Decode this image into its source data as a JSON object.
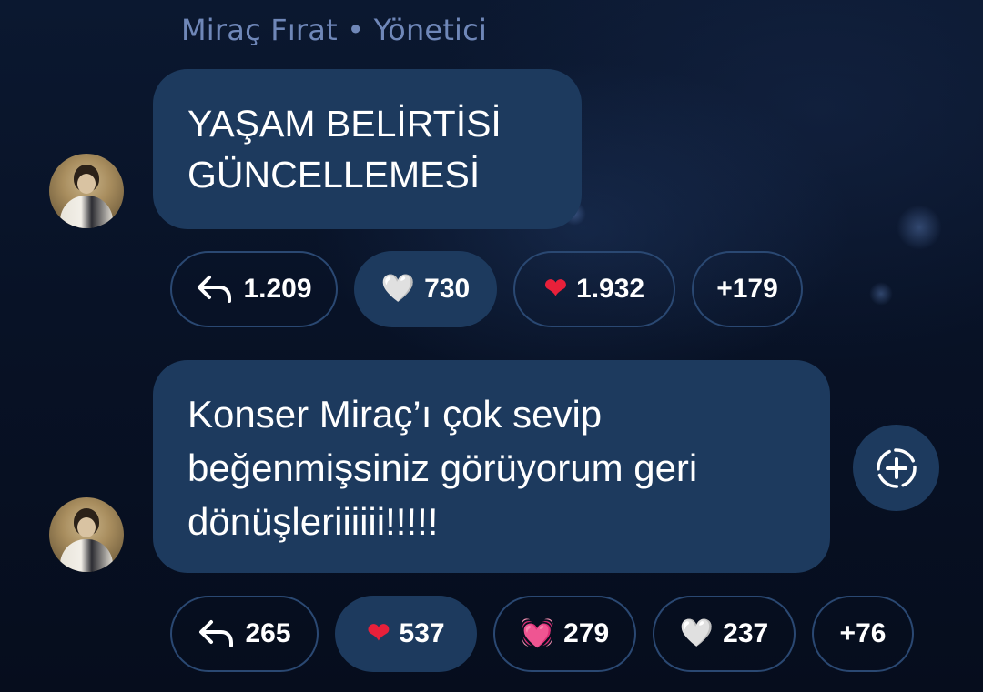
{
  "sender": {
    "name": "Miraç Fırat",
    "separator": "•",
    "role": "Yönetici"
  },
  "messages": [
    {
      "text": "YAŞAM BELİRTİSİ\nGÜNCELLEMESİ",
      "reactions": [
        {
          "icon": "reply-arrow-icon",
          "count": "1.209",
          "active": false
        },
        {
          "icon": "white-heart",
          "emoji": "🤍",
          "count": "730",
          "active": true
        },
        {
          "icon": "red-heart",
          "emoji": "❤",
          "count": "1.932",
          "active": false
        },
        {
          "label": "+179",
          "active": false
        }
      ]
    },
    {
      "text": "Konser Miraç’ı çok sevip\nbeğenmişsiniz görüyorum geri\ndönüşleriiiiii!!!!!",
      "reactions": [
        {
          "icon": "reply-arrow-icon",
          "count": "265",
          "active": false
        },
        {
          "icon": "red-heart",
          "emoji": "❤",
          "count": "537",
          "active": true
        },
        {
          "icon": "beating-heart",
          "emoji": "💓",
          "count": "279",
          "active": false
        },
        {
          "icon": "white-heart",
          "emoji": "🤍",
          "count": "237",
          "active": false
        },
        {
          "label": "+76",
          "active": false
        }
      ]
    }
  ],
  "add_reaction_icon": "add-reaction-icon",
  "colors": {
    "bubble": "#1d3a5e",
    "chip_border": "#2a4872",
    "sender_text": "#6f87b8",
    "background": "#081226"
  }
}
